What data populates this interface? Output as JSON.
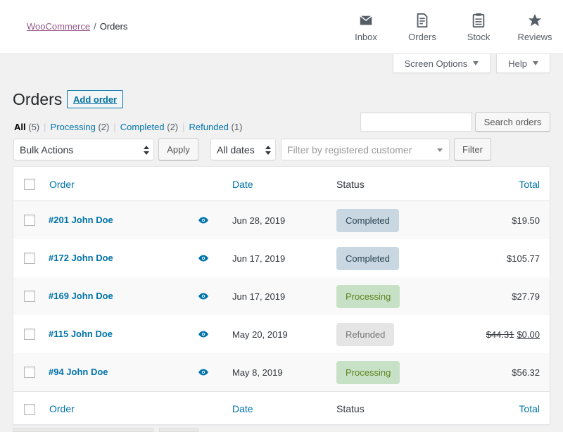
{
  "breadcrumb": {
    "root": "WooCommerce",
    "separator": "/",
    "current": "Orders"
  },
  "activity_tabs": [
    {
      "label": "Inbox",
      "icon": "inbox-icon"
    },
    {
      "label": "Orders",
      "icon": "orders-page-icon"
    },
    {
      "label": "Stock",
      "icon": "clipboard-icon"
    },
    {
      "label": "Reviews",
      "icon": "star-icon"
    }
  ],
  "screen_meta": {
    "screen_options": "Screen Options",
    "help": "Help"
  },
  "page": {
    "title": "Orders",
    "add_order": "Add order"
  },
  "views": {
    "all": "All",
    "all_count": "(5)",
    "processing": "Processing",
    "processing_count": "(2)",
    "completed": "Completed",
    "completed_count": "(2)",
    "refunded": "Refunded",
    "refunded_count": "(1)"
  },
  "search": {
    "value": "",
    "button": "Search orders"
  },
  "filters": {
    "bulk_actions": "Bulk Actions",
    "apply": "Apply",
    "dates": "All dates",
    "customer_placeholder": "Filter by registered customer",
    "filter": "Filter"
  },
  "table": {
    "columns": {
      "order": "Order",
      "date": "Date",
      "status": "Status",
      "total": "Total"
    },
    "rows": [
      {
        "order": "#201 John Doe",
        "date": "Jun 28, 2019",
        "status": "Completed",
        "total": "$19.50"
      },
      {
        "order": "#172 John Doe",
        "date": "Jun 17, 2019",
        "status": "Completed",
        "total": "$105.77"
      },
      {
        "order": "#169 John Doe",
        "date": "Jun 17, 2019",
        "status": "Processing",
        "total": "$27.79"
      },
      {
        "order": "#115 John Doe",
        "date": "May 20, 2019",
        "status": "Refunded",
        "total_original": "$44.31",
        "total": "$0.00"
      },
      {
        "order": "#94 John Doe",
        "date": "May 8, 2019",
        "status": "Processing",
        "total": "$56.32"
      }
    ]
  },
  "colors": {
    "link": "#0073aa",
    "brand": "#96588a",
    "completed_bg": "#c8d7e1",
    "processing_bg": "#c6e1c6",
    "refunded_bg": "#e5e5e5"
  }
}
